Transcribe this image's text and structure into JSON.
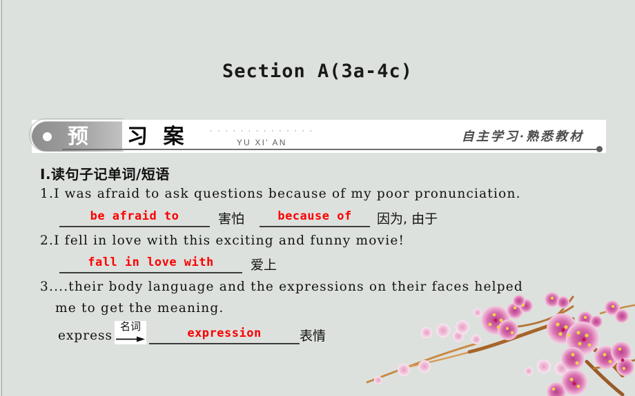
{
  "slide": {
    "title": "Section A(3a-4c)",
    "background_color": "#dde1dd"
  },
  "banner": {
    "pill_char": "预",
    "chars": "习 案",
    "pinyin_dots": "· · · · · · · · · · · · · ·",
    "pinyin": "YU XI' AN",
    "motto": "自主学习·熟悉教材"
  },
  "content": {
    "section_heading": "Ⅰ.读句子记单词/短语",
    "items": [
      {
        "number": "1.",
        "sentence": "I was afraid to ask questions because of my poor pronunciation.",
        "answers": [
          {
            "blank": "be afraid to",
            "gloss": "害怕"
          },
          {
            "blank": "because of",
            "gloss": "因为, 由于"
          }
        ]
      },
      {
        "number": "2.",
        "sentence": "I fell in love with this exciting and funny movie!",
        "answers": [
          {
            "blank": "fall in love with",
            "gloss": "爱上"
          }
        ]
      },
      {
        "number": "3.",
        "sentence": "...their body language and the expressions on their faces helped",
        "sentence_cont": "me to get the meaning.",
        "derivation": {
          "base_word": "express",
          "pos_label": "名词",
          "blank": "expression",
          "gloss": "表情"
        }
      }
    ]
  },
  "decoration": {
    "name": "plum-blossom-branch",
    "flower_color": "#d76fb0",
    "flower_center_color": "#f3d14a",
    "branch_color": "#a8642b"
  }
}
